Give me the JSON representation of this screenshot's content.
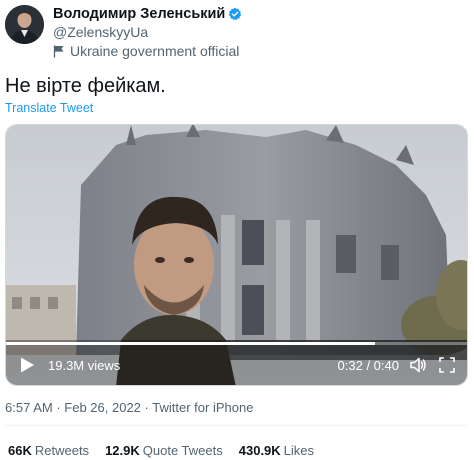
{
  "author": {
    "name": "Володимир Зеленський",
    "handle": "@ZelenskyyUa",
    "label": "Ukraine government official"
  },
  "tweet": {
    "text": "Не вірте фейкам.",
    "translate_label": "Translate Tweet"
  },
  "video": {
    "views": "19.3M views",
    "time": "0:32 / 0:40",
    "progress": 0.8
  },
  "meta": {
    "time": "6:57 AM",
    "date": "Feb 26, 2022",
    "source": "Twitter for iPhone",
    "separator": "·"
  },
  "stats": {
    "retweets_count": "66K",
    "retweets_label": "Retweets",
    "quotes_count": "12.9K",
    "quotes_label": "Quote Tweets",
    "likes_count": "430.9K",
    "likes_label": "Likes"
  },
  "colors": {
    "accent": "#1d9bf0",
    "text": "#0f1419",
    "secondary": "#536471"
  }
}
